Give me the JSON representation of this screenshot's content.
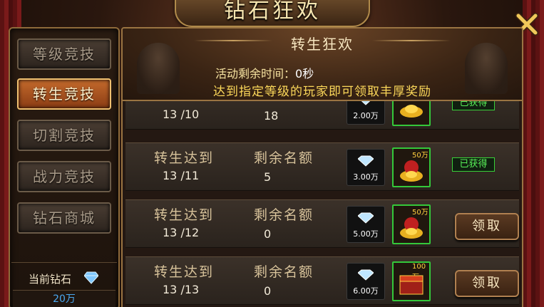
{
  "window": {
    "title": "钻石狂欢"
  },
  "sidebar": {
    "items": [
      {
        "label": "等级竞技",
        "active": false
      },
      {
        "label": "转生竞技",
        "active": true
      },
      {
        "label": "切割竞技",
        "active": false
      },
      {
        "label": "战力竞技",
        "active": false
      },
      {
        "label": "钻石商城",
        "active": false
      }
    ],
    "balance_label": "当前钻石",
    "balance_value": "20万",
    "balance_icon": "diamond-icon"
  },
  "main": {
    "title": "转生狂欢",
    "timer_label": "活动剩余时间：",
    "timer_value": "0秒",
    "description": "达到指定等级的玩家即可领取丰厚奖励"
  },
  "rows": [
    {
      "title": "",
      "level": "13 /10",
      "quota_label": "",
      "quota_value": "18",
      "diamond_amount": "2.00万",
      "gift_amount": "",
      "status": "已获得",
      "claim": ""
    },
    {
      "title": "转生达到",
      "level": "13 /11",
      "quota_label": "剩余名额",
      "quota_value": "5",
      "diamond_amount": "3.00万",
      "gift_amount": "50万",
      "status": "已获得",
      "claim": ""
    },
    {
      "title": "转生达到",
      "level": "13 /12",
      "quota_label": "剩余名额",
      "quota_value": "0",
      "diamond_amount": "5.00万",
      "gift_amount": "50万",
      "status": "",
      "claim": "领取"
    },
    {
      "title": "转生达到",
      "level": "13 /13",
      "quota_label": "剩余名额",
      "quota_value": "0",
      "diamond_amount": "6.00万",
      "gift_amount": "100万",
      "status": "",
      "claim": "领取"
    }
  ],
  "colors": {
    "accent": "#c46a2c",
    "gold_text": "#fcd85a",
    "claimed_green": "#58f058",
    "diamond_blue": "#4aa8f0"
  }
}
